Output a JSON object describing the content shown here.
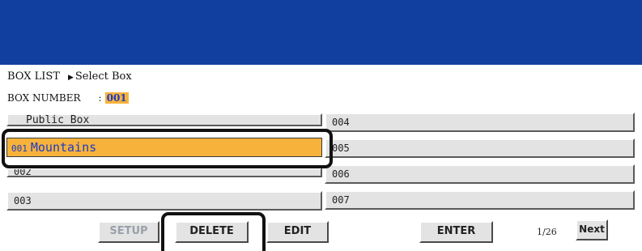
{
  "breadcrumb": {
    "root": "BOX LIST",
    "current": "Select Box"
  },
  "box_number": {
    "label": "BOX NUMBER",
    "separator": ":",
    "value": "001"
  },
  "box_list": {
    "left": [
      {
        "label": "Public Box"
      },
      {
        "number": "001",
        "name": "Mountains",
        "selected": true
      },
      {
        "label": "002"
      },
      {
        "label": "003"
      }
    ],
    "right": [
      {
        "label": "004"
      },
      {
        "label": "005"
      },
      {
        "label": "006"
      },
      {
        "label": "007"
      }
    ]
  },
  "buttons": {
    "setup": "SETUP",
    "delete": "DELETE",
    "edit": "EDIT",
    "enter": "ENTER",
    "next": "Next"
  },
  "pagination": {
    "current": "1",
    "total": "26",
    "text": "1/26"
  },
  "colors": {
    "header": "#103fa0",
    "selected": "#f7b23b",
    "selected_text": "#1a3bc8",
    "button": "#e3e3e3"
  }
}
